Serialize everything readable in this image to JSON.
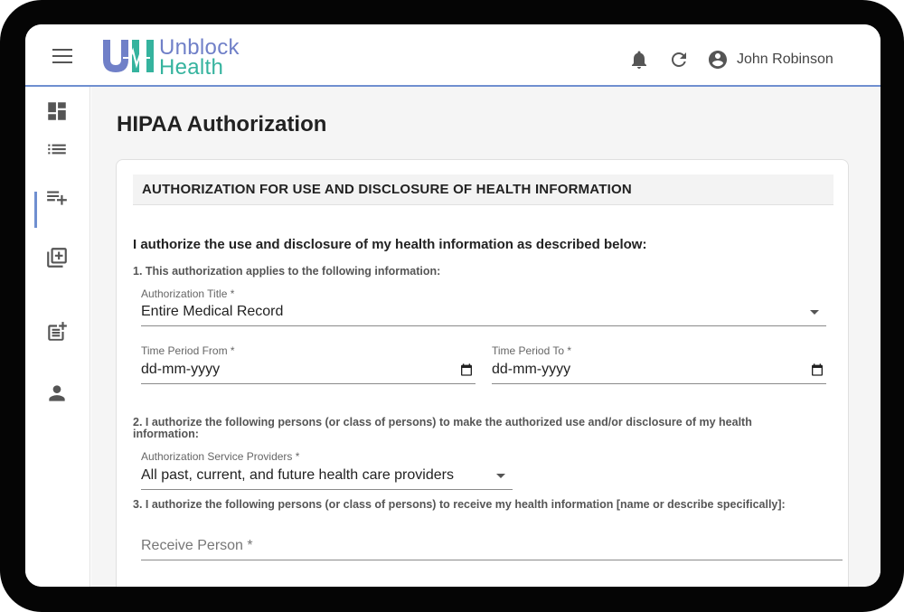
{
  "app": {
    "logo_line1": "Unblock",
    "logo_line2": "Health",
    "user_name": "John Robinson"
  },
  "sidebar": {
    "items": [
      {
        "icon": "dashboard-icon"
      },
      {
        "icon": "list-icon",
        "active": true
      },
      {
        "icon": "playlist-add-icon"
      },
      {
        "icon": "library-add-icon"
      },
      {
        "icon": "post-add-icon"
      },
      {
        "icon": "person-icon"
      }
    ]
  },
  "page": {
    "title": "HIPAA Authorization",
    "section_header": "AUTHORIZATION FOR USE AND DISCLOSURE OF HEALTH INFORMATION",
    "intro": "I authorize the use and disclosure of my health information as described below:",
    "q1": "1. This authorization applies to the following information:",
    "auth_title_label": "Authorization Title *",
    "auth_title_value": "Entire Medical Record",
    "period_from_label": "Time Period From *",
    "period_from_value": "dd-mm-yyyy",
    "period_to_label": "Time Period To *",
    "period_to_value": "dd-mm-yyyy",
    "q2": "2. I authorize the following persons (or class of persons) to make the authorized use and/or disclosure of my health information:",
    "providers_label": "Authorization Service Providers *",
    "providers_value": "All past, current, and future health care providers",
    "q3": "3. I authorize the following persons (or class of persons) to receive my health information [name or describe specifically]:",
    "receive_placeholder": "Receive Person *"
  },
  "colors": {
    "accent": "#6f8fd0",
    "logo_blue": "#7080c8",
    "logo_green": "#35b39e"
  }
}
